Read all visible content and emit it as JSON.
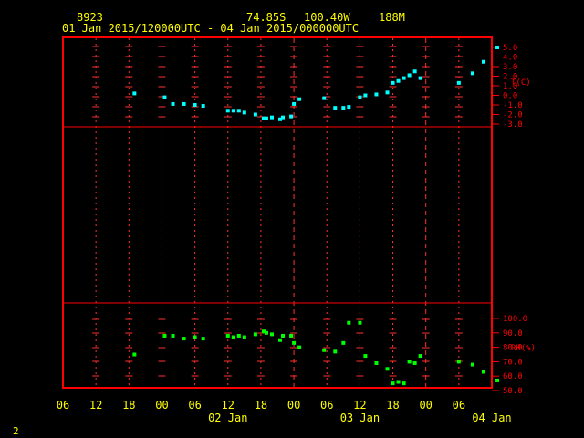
{
  "header": {
    "station_id": "8923",
    "latitude": "74.85S",
    "longitude": "100.40W",
    "elevation": "188M",
    "time_range": "01 Jan 2015/120000UTC - 04 Jan 2015/000000UTC"
  },
  "footer": {
    "frame_number": "2"
  },
  "colors": {
    "frame": "#ff0000",
    "grid": "#ff3030",
    "text": "#ffff00",
    "temperature": "#00ffff",
    "humidity": "#00ff00"
  },
  "x_axis": {
    "hour_ticks": [
      "06",
      "12",
      "18",
      "00",
      "06",
      "12",
      "18",
      "00",
      "06",
      "12",
      "18",
      "00",
      "06"
    ],
    "day_labels": [
      {
        "label": "02 Jan",
        "hours_from_start": 30
      },
      {
        "label": "03 Jan",
        "hours_from_start": 54
      },
      {
        "label": "04 Jan",
        "hours_from_start": 78
      }
    ]
  },
  "chart_data": [
    {
      "type": "scatter",
      "ylabel": "T(C)",
      "ylim": [
        -3.0,
        5.0
      ],
      "yticks": [
        "5.0",
        "4.0",
        "3.0",
        "2.0",
        "1.0",
        "0.0",
        "-1.0",
        "-2.0",
        "-3.0"
      ],
      "series": [
        {
          "x": [
            13,
            18.5,
            20,
            22,
            24,
            25.5,
            30,
            31,
            32,
            33,
            35,
            36.5,
            37,
            38,
            39.5,
            40,
            41.5,
            42,
            43,
            47.5,
            49.5,
            51,
            52,
            54,
            55,
            57,
            59,
            60,
            61,
            62,
            63,
            64,
            65,
            72,
            74.5,
            76.5,
            79
          ],
          "y": [
            0.2,
            -0.2,
            -0.9,
            -0.9,
            -1.0,
            -1.1,
            -1.6,
            -1.6,
            -1.6,
            -1.8,
            -2.0,
            -2.4,
            -2.4,
            -2.3,
            -2.5,
            -2.3,
            -2.2,
            -0.9,
            -0.4,
            -0.3,
            -1.3,
            -1.3,
            -1.2,
            -0.2,
            0.0,
            0.1,
            0.3,
            1.3,
            1.5,
            1.8,
            2.1,
            2.5,
            1.8,
            1.3,
            2.3,
            3.5,
            5.0
          ]
        }
      ]
    },
    {
      "type": "scatter",
      "ylabel": "RH(%)",
      "ylim": [
        50.0,
        100.0
      ],
      "yticks": [
        "100.0",
        "90.0",
        "80.0",
        "70.0",
        "60.0",
        "50.0"
      ],
      "series": [
        {
          "x": [
            13,
            18.5,
            20,
            22,
            24,
            25.5,
            30,
            31,
            32,
            33,
            35,
            36.5,
            37,
            38,
            39.5,
            40,
            41.5,
            42,
            43,
            47.5,
            49.5,
            51,
            52,
            54,
            55,
            57,
            59,
            60,
            61,
            62,
            63,
            64,
            65,
            72,
            74.5,
            76.5,
            79
          ],
          "y": [
            75,
            88,
            88,
            86,
            87,
            86,
            88,
            87,
            88,
            87,
            89,
            91,
            90,
            89,
            85,
            88,
            88,
            83,
            80,
            78,
            77,
            83,
            97,
            97,
            74,
            69,
            65,
            55,
            56,
            55,
            70,
            69,
            74,
            70,
            68,
            63,
            57
          ]
        }
      ]
    }
  ]
}
